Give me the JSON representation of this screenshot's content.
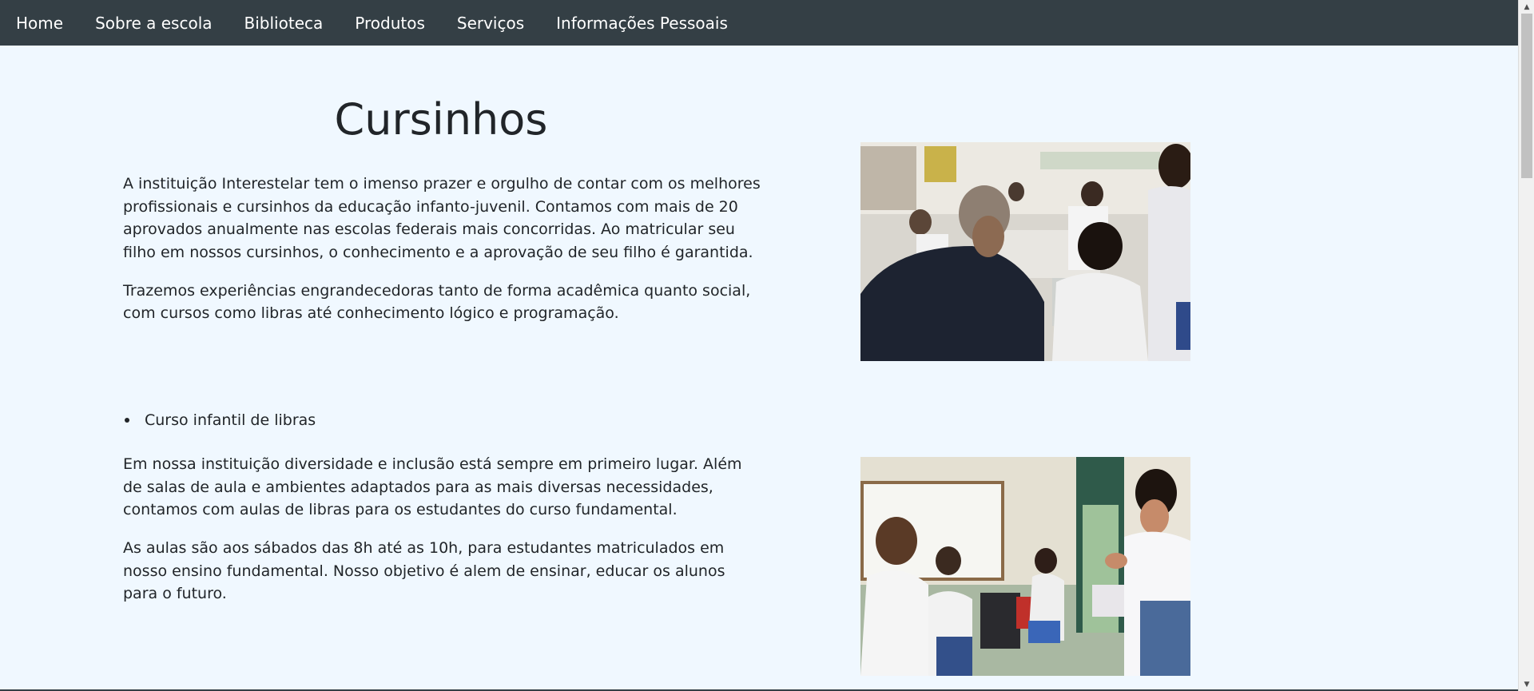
{
  "navbar": {
    "items": [
      {
        "label": "Home"
      },
      {
        "label": "Sobre a escola"
      },
      {
        "label": "Biblioteca"
      },
      {
        "label": "Produtos"
      },
      {
        "label": "Serviços"
      },
      {
        "label": "Informações Pessoais"
      }
    ]
  },
  "main": {
    "title": "Cursinhos",
    "intro": [
      "A instituição Interestelar tem o imenso prazer e orgulho de contar com os melhores profissionais e cursinhos da educação infanto-juvenil. Contamos com mais de 20 aprovados anualmente nas escolas federais mais concorridas. Ao matricular seu filho em nossos cursinhos, o conhecimento e a aprovação de seu filho é garantida.",
      "Trazemos experiências engrandecedoras tanto de forma acadêmica quanto social, com cursos como libras até conhecimento lógico e programação."
    ],
    "course": {
      "name": "Curso infantil de libras",
      "paragraphs": [
        "Em nossa instituição diversidade e inclusão está sempre em primeiro lugar. Além de salas de aula e ambientes adaptados para as mais diversas necessidades, contamos com aulas de libras para os estudantes do curso fundamental.",
        "As aulas são aos sábados das 8h até as 10h, para estudantes matriculados em nosso ensino fundamental. Nosso objetivo é alem de ensinar, educar os alunos para o futuro."
      ]
    }
  },
  "colors": {
    "navbar_bg": "#343f45",
    "page_bg": "#f0f8ff",
    "text": "#212529"
  }
}
